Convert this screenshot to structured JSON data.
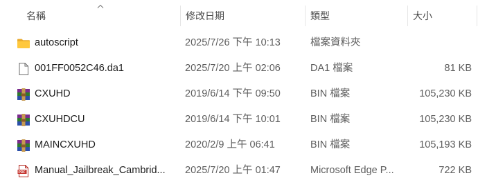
{
  "header": {
    "col_name": "名稱",
    "col_date": "修改日期",
    "col_type": "類型",
    "col_size": "大小",
    "sort_indicator": "chevron-up-icon"
  },
  "files": [
    {
      "icon": "folder-icon",
      "name": "autoscript",
      "date": "2025/7/26 下午 10:13",
      "type": "檔案資料夾",
      "size": ""
    },
    {
      "icon": "document-icon",
      "name": "001FF0052C46.da1",
      "date": "2025/7/20 上午 02:06",
      "type": "DA1 檔案",
      "size": "81 KB"
    },
    {
      "icon": "archive-icon",
      "name": "CXUHD",
      "date": "2019/6/14 下午 09:50",
      "type": "BIN 檔案",
      "size": "105,230 KB"
    },
    {
      "icon": "archive-icon",
      "name": "CXUHDCU",
      "date": "2019/6/14 下午 10:01",
      "type": "BIN 檔案",
      "size": "105,230 KB"
    },
    {
      "icon": "archive-icon",
      "name": "MAINCXUHD",
      "date": "2020/2/9 上午 06:41",
      "type": "BIN 檔案",
      "size": "105,193 KB"
    },
    {
      "icon": "pdf-icon",
      "name": "Manual_Jailbreak_Cambrid...",
      "date": "2025/7/20 上午 01:47",
      "type": "Microsoft Edge P...",
      "size": "722 KB"
    }
  ]
}
